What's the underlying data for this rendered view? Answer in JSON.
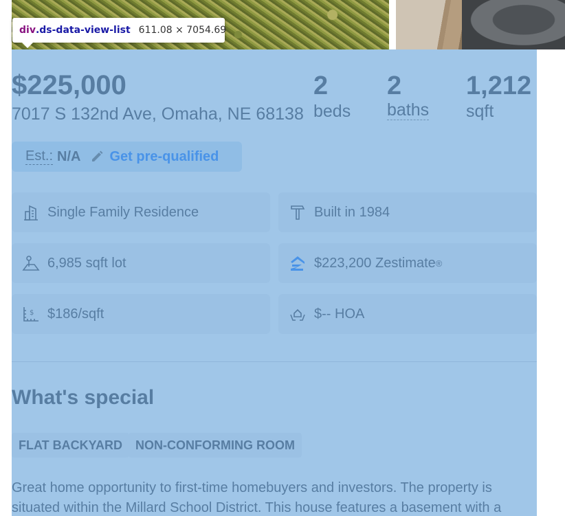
{
  "devtools_tooltip": {
    "tag": "div",
    "class_name": ".ds-data-view-list",
    "size": "611.08 × 7054.69"
  },
  "listing": {
    "price": "$225,000",
    "address": "7017 S 132nd Ave, Omaha, NE 68138",
    "beds": {
      "value": "2",
      "label": "beds"
    },
    "baths": {
      "value": "2",
      "label": "baths"
    },
    "sqft": {
      "value": "1,212",
      "label": "sqft"
    }
  },
  "estimate": {
    "label": "Est.:",
    "value": "N/A",
    "prequal_link": "Get pre-qualified"
  },
  "facts": [
    {
      "icon": "building-icon",
      "text": "Single Family Residence"
    },
    {
      "icon": "hammer-icon",
      "text": "Built in 1984"
    },
    {
      "icon": "lot-icon",
      "text": "6,985 sqft lot"
    },
    {
      "icon": "zestimate-logo-icon",
      "text": "$223,200 Zestimate",
      "sup": "®"
    },
    {
      "icon": "price-per-sqft-icon",
      "text": "$186/sqft"
    },
    {
      "icon": "hoa-icon",
      "text": "$-- HOA"
    }
  ],
  "whats_special": {
    "title": "What's special",
    "tags": [
      "FLAT BACKYARD",
      "NON-CONFORMING ROOM"
    ],
    "description": "Great home opportunity to first-time homebuyers and investors. The property is situated within the Millard School District. This house features a basement with a"
  },
  "colors": {
    "highlight": "#6fa8dc",
    "link": "#006aff",
    "pill_bg": "#d1e4f7"
  }
}
